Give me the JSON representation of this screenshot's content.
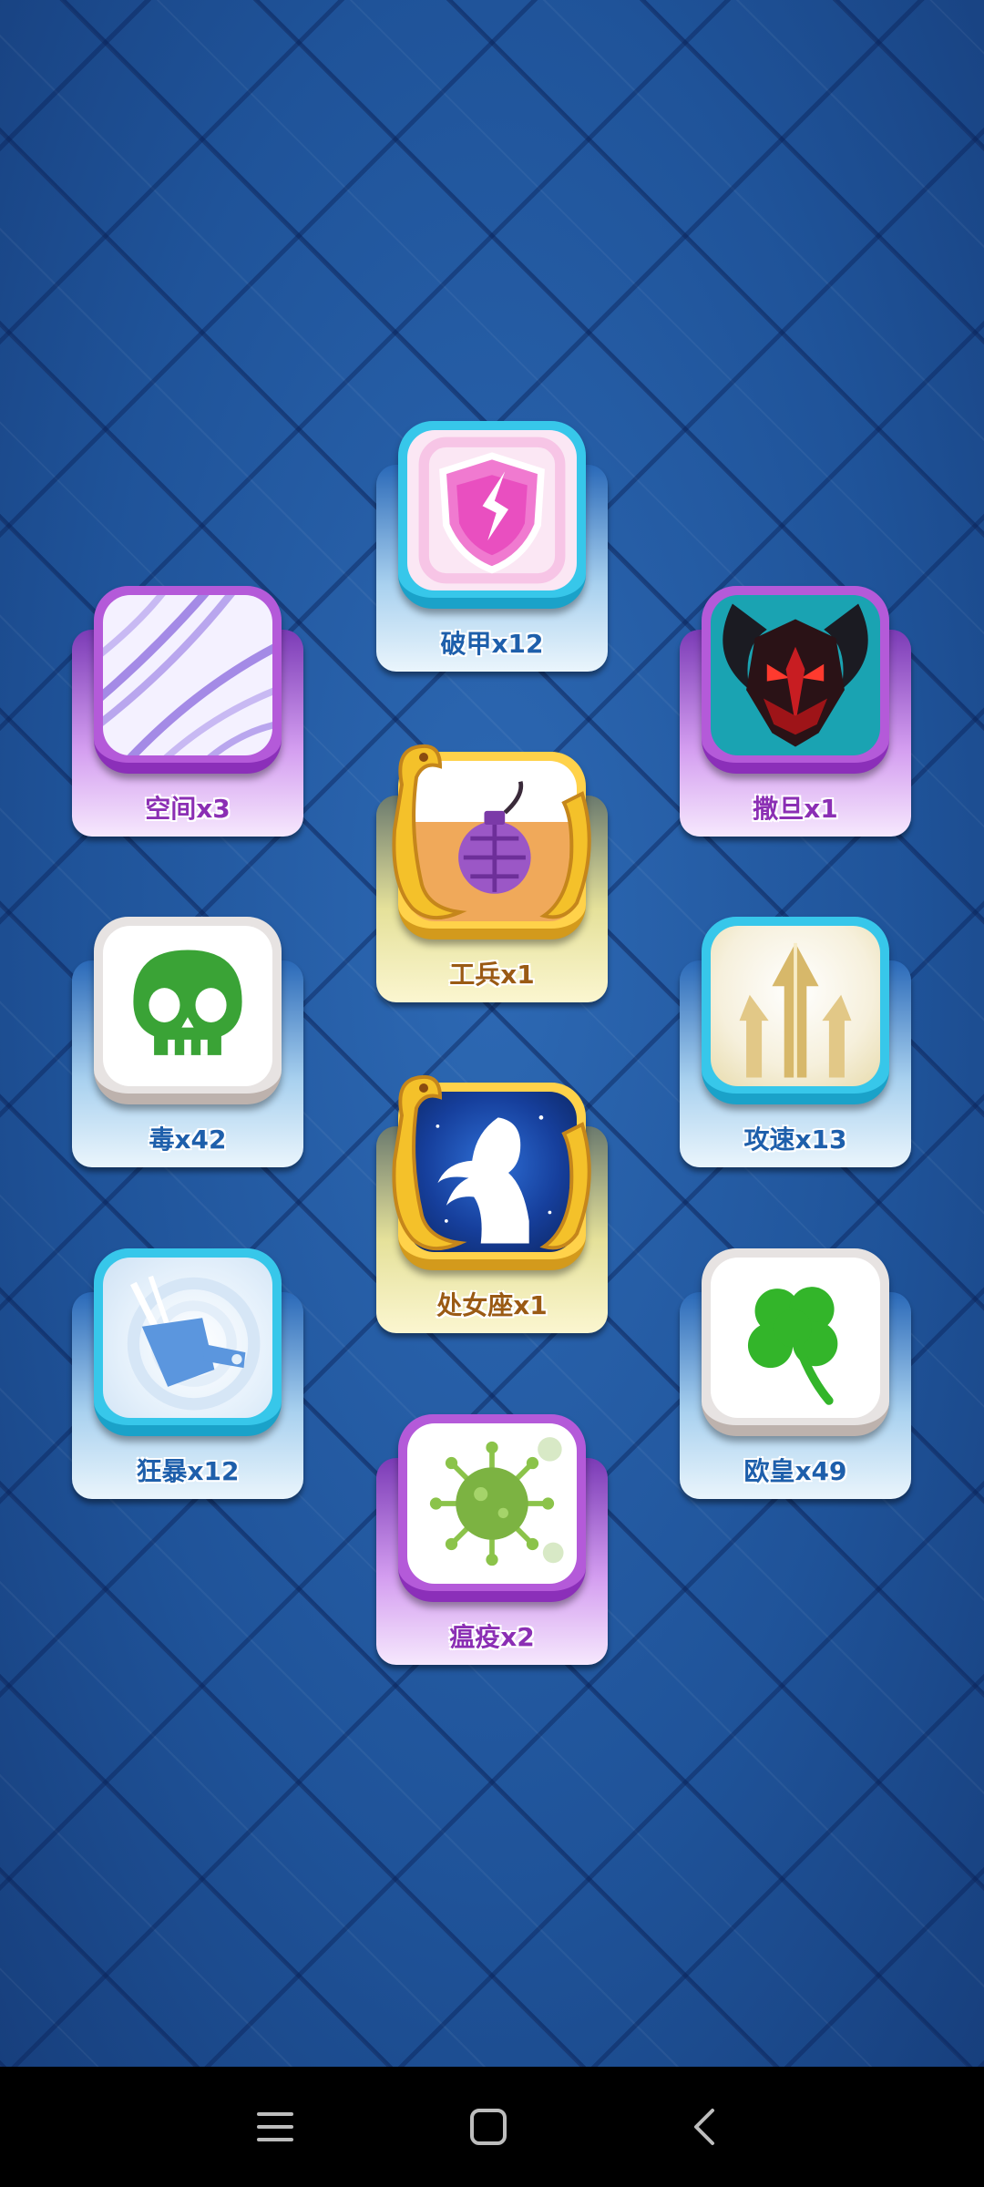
{
  "skills": [
    {
      "id": "armor-break",
      "label": "破甲x12",
      "theme": "cyan",
      "icon": "broken-shield-icon"
    },
    {
      "id": "space",
      "label": "空间x3",
      "theme": "purple",
      "icon": "space-ripple-icon"
    },
    {
      "id": "satan",
      "label": "撒旦x1",
      "theme": "purple",
      "icon": "demon-mask-icon"
    },
    {
      "id": "engineer",
      "label": "工兵x1",
      "theme": "gold",
      "icon": "grenade-icon"
    },
    {
      "id": "poison",
      "label": "毒x42",
      "theme": "blue",
      "icon": "skull-icon"
    },
    {
      "id": "attack-speed",
      "label": "攻速x13",
      "theme": "cyan",
      "icon": "arrow-blade-icon"
    },
    {
      "id": "virgo",
      "label": "处女座x1",
      "theme": "gold",
      "icon": "virgo-silhouette-icon"
    },
    {
      "id": "berserk",
      "label": "狂暴x12",
      "theme": "cyan",
      "icon": "hammer-swirl-icon"
    },
    {
      "id": "lucky",
      "label": "欧皇x49",
      "theme": "blue",
      "icon": "clover-icon"
    },
    {
      "id": "plague",
      "label": "瘟疫x2",
      "theme": "purple",
      "icon": "virus-icon"
    }
  ],
  "navigation": {
    "menu_icon": "menu-icon",
    "home_icon": "home-square-icon",
    "back_icon": "back-chevron-icon"
  },
  "colors": {
    "background": "#24599f",
    "label_blue": "#1e5fab",
    "label_purple": "#8b2fb4",
    "label_gold": "#9a5a14",
    "nav_bar": "#000000"
  }
}
